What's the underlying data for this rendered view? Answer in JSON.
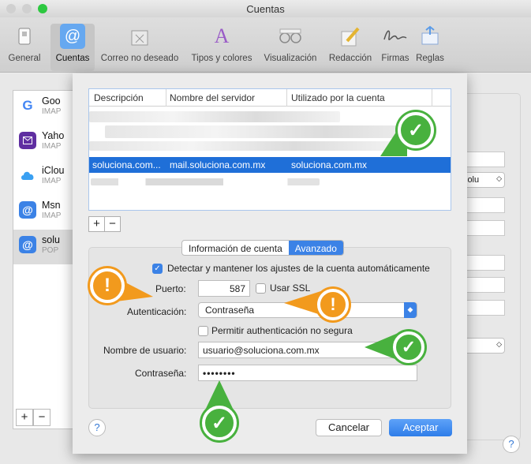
{
  "window": {
    "title": "Cuentas"
  },
  "toolbar": {
    "items": [
      {
        "label": "General",
        "icon": "switch-icon"
      },
      {
        "label": "Cuentas",
        "icon": "at-icon"
      },
      {
        "label": "Correo no deseado",
        "icon": "junk-trash-icon"
      },
      {
        "label": "Tipos y colores",
        "icon": "fonts-colors-icon"
      },
      {
        "label": "Visualización",
        "icon": "glasses-icon"
      },
      {
        "label": "Redacción",
        "icon": "pencil-icon"
      },
      {
        "label": "Firmas",
        "icon": "signature-icon"
      },
      {
        "label": "Reglas",
        "icon": "rules-icon"
      }
    ]
  },
  "accounts": [
    {
      "name": "Goo",
      "sub": "IMAP",
      "color": "#ffffff"
    },
    {
      "name": "Yaho",
      "sub": "IMAP",
      "color": "#5f2ea1"
    },
    {
      "name": "iClou",
      "sub": "IMAP",
      "color": "#3aa0f2"
    },
    {
      "name": "Msn",
      "sub": "IMAP",
      "color": "#3b82e6"
    },
    {
      "name": "solu",
      "sub": "POP",
      "color": "#3b82e6"
    }
  ],
  "right_panel": {
    "select1": "Ɔsolu",
    "select1_arrow": "◇",
    "select2_arrow": "◇"
  },
  "sheet": {
    "table": {
      "headers": [
        "Descripción",
        "Nombre del servidor",
        "Utilizado por la cuenta"
      ],
      "selected_row": [
        "solucionа.com...",
        "mail.soluciona.com.mx",
        "soluciona.com.mx"
      ]
    },
    "table_plus": "+",
    "table_minus": "−",
    "tabs": [
      "Información de cuenta",
      "Avanzado"
    ],
    "auto_detect_label": "Detectar y mantener los ajustes de la cuenta automáticamente",
    "port_label": "Puerto:",
    "port_value": "587",
    "ssl_label": "Usar SSL",
    "auth_label": "Autenticación:",
    "auth_value": "Contraseña",
    "insecure_label": "Permitir authenticación no segura",
    "username_label": "Nombre de usuario:",
    "username_value": "usuario@soluciona.com.mx",
    "password_label": "Contraseña:",
    "password_value": "••••••••",
    "cancel": "Cancelar",
    "accept": "Aceptar",
    "help": "?"
  },
  "bottom": {
    "plus": "+",
    "minus": "−",
    "help": "?"
  },
  "annotations": {
    "check": "✓",
    "warn": "!"
  }
}
